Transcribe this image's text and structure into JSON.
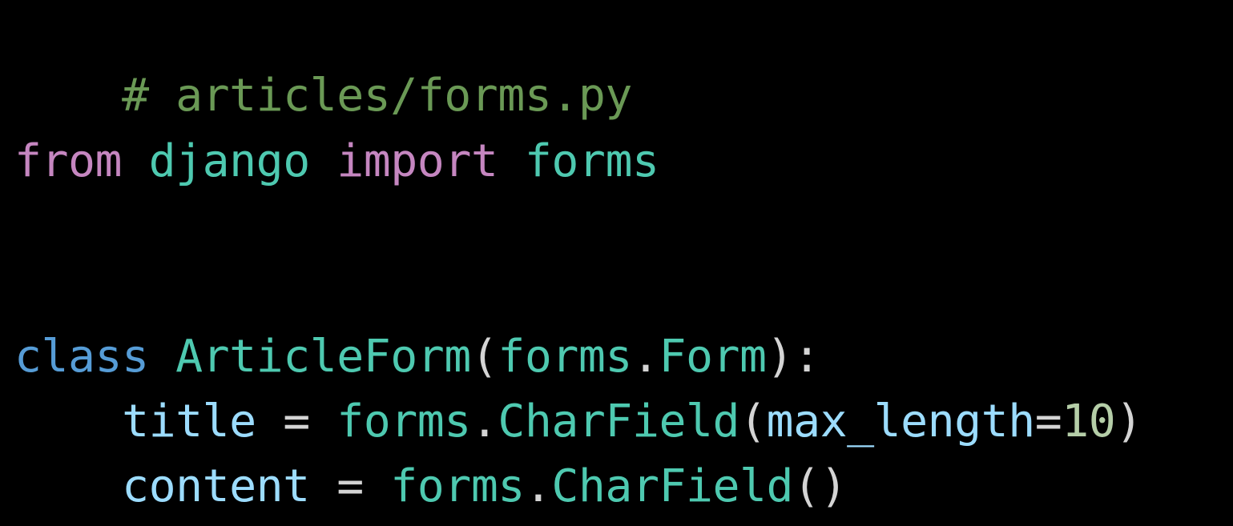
{
  "code": {
    "line1": {
      "comment": "# articles/forms.py"
    },
    "line3": {
      "kw_from": "from",
      "module": "django",
      "kw_import": "import",
      "name": "forms"
    },
    "line6": {
      "kw_class": "class",
      "class_name": "ArticleForm",
      "paren_open": "(",
      "base_module": "forms",
      "dot": ".",
      "base_class": "Form",
      "paren_close": ")",
      "colon": ":"
    },
    "line7": {
      "indent": "    ",
      "var": "title",
      "assign": " = ",
      "module": "forms",
      "dot": ".",
      "field": "CharField",
      "paren_open": "(",
      "kwarg": "max_length",
      "equals": "=",
      "number": "10",
      "paren_close": ")"
    },
    "line8": {
      "indent": "    ",
      "var": "content",
      "assign": " = ",
      "module": "forms",
      "dot": ".",
      "field": "CharField",
      "parens": "()"
    }
  },
  "colors": {
    "background": "#000000",
    "comment": "#6a9955",
    "keyword": "#c586c0",
    "storage": "#569cd6",
    "class_name": "#4ec9b0",
    "variable": "#9cdcfe",
    "number": "#b5cea8",
    "punctuation": "#d4d4d4"
  }
}
